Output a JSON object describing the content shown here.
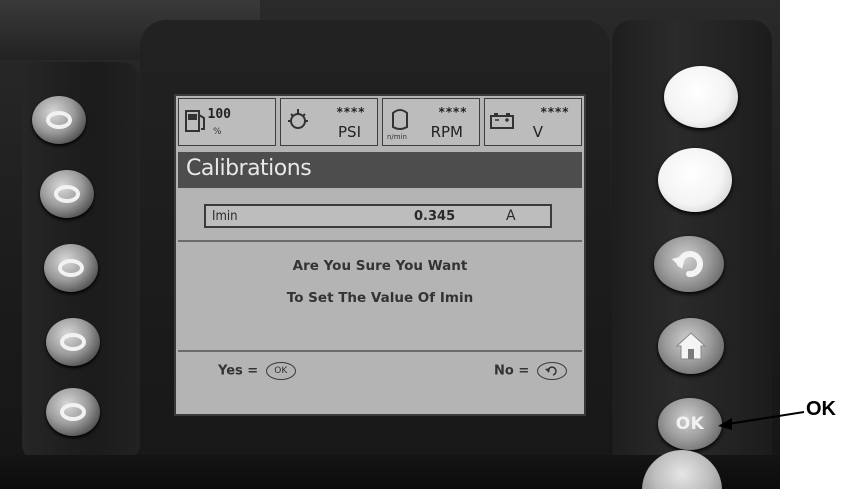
{
  "status_bar": {
    "fuel": {
      "icon": "fuel-pump-icon",
      "value": "100",
      "subunit": "%"
    },
    "oil_pressure": {
      "icon": "oil-pressure-icon",
      "value": "****",
      "unit": "PSI"
    },
    "engine_speed": {
      "icon": "engine-icon",
      "value": "****",
      "unit": "RPM",
      "subunit": "n/min"
    },
    "battery": {
      "icon": "battery-icon",
      "value": "****",
      "unit": "V"
    }
  },
  "screen": {
    "title": "Calibrations",
    "setting": {
      "label": "Imin",
      "value": "0.345",
      "unit": "A"
    },
    "message_line_1": "Are You Sure You Want",
    "message_line_2": "To Set The Value Of Imin",
    "yes_label": "Yes =",
    "yes_key": "OK",
    "no_label": "No ="
  },
  "buttons": {
    "ok_label": "OK"
  },
  "annotation": {
    "callout": "OK"
  }
}
